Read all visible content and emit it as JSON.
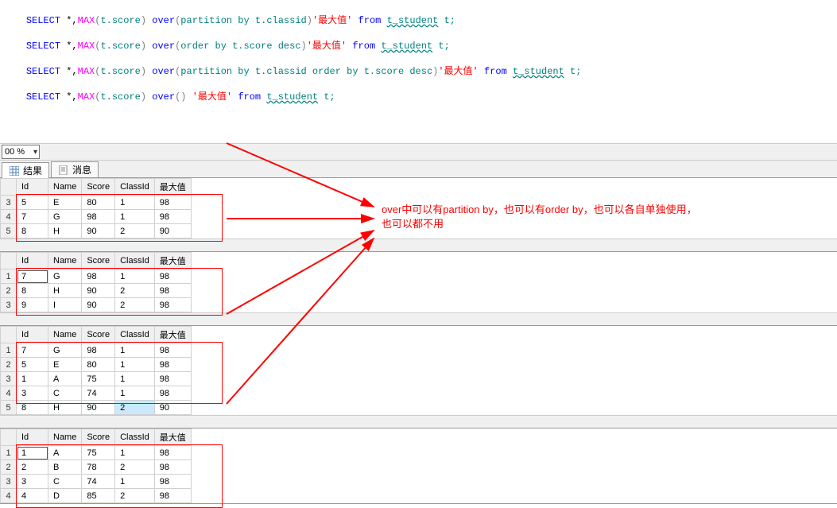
{
  "sql": {
    "line1": {
      "s": "SELECT",
      "star": "*,",
      "fn": "MAX",
      "paren1": "(",
      "arg": "t.score",
      "paren2": ")",
      "over": "over",
      "po": "(",
      "pc": "partition by t.classid",
      "pe": ")",
      "alias": "'最大值'",
      "from": "from",
      "tbl": "t_student",
      "t": "t;"
    },
    "line2": {
      "s": "SELECT",
      "star": "*,",
      "fn": "MAX",
      "paren1": "(",
      "arg": "t.score",
      "paren2": ")",
      "over": "over",
      "po": "(",
      "pc": "order by t.score desc",
      "pe": ")",
      "alias": "'最大值'",
      "from": "from",
      "tbl": "t_student",
      "t": "t;"
    },
    "line3": {
      "s": "SELECT",
      "star": "*,",
      "fn": "MAX",
      "paren1": "(",
      "arg": "t.score",
      "paren2": ")",
      "over": "over",
      "po": "(",
      "pc": "partition by t.classid order by t.score desc",
      "pe": ")",
      "alias": "'最大值'",
      "from": "from",
      "tbl": "t_student",
      "t": "t;"
    },
    "line4": {
      "s": "SELECT",
      "star": "*,",
      "fn": "MAX",
      "paren1": "(",
      "arg": "t.score",
      "paren2": ")",
      "over": "over",
      "po": "(",
      "pc": "",
      "pe": ")",
      "alias": "'最大值'",
      "from": "from",
      "tbl": "t_student",
      "t": "t;"
    }
  },
  "zoom": "00 %",
  "tabs": {
    "results": "结果",
    "messages": "消息"
  },
  "columns": [
    "Id",
    "Name",
    "Score",
    "ClassId",
    "最大值"
  ],
  "grid1": {
    "startRow": 3,
    "rows": [
      [
        "5",
        "E",
        "80",
        "1",
        "98"
      ],
      [
        "7",
        "G",
        "98",
        "1",
        "98"
      ],
      [
        "8",
        "H",
        "90",
        "2",
        "90"
      ]
    ]
  },
  "grid2": {
    "rows": [
      [
        "7",
        "G",
        "98",
        "1",
        "98"
      ],
      [
        "8",
        "H",
        "90",
        "2",
        "98"
      ],
      [
        "9",
        "I",
        "90",
        "2",
        "98"
      ]
    ]
  },
  "grid3": {
    "rows": [
      [
        "7",
        "G",
        "98",
        "1",
        "98"
      ],
      [
        "5",
        "E",
        "80",
        "1",
        "98"
      ],
      [
        "1",
        "A",
        "75",
        "1",
        "98"
      ],
      [
        "3",
        "C",
        "74",
        "1",
        "98"
      ],
      [
        "8",
        "H",
        "90",
        "2",
        "90"
      ]
    ]
  },
  "grid4": {
    "rows": [
      [
        "1",
        "A",
        "75",
        "1",
        "98"
      ],
      [
        "2",
        "B",
        "78",
        "2",
        "98"
      ],
      [
        "3",
        "C",
        "74",
        "1",
        "98"
      ],
      [
        "4",
        "D",
        "85",
        "2",
        "98"
      ]
    ]
  },
  "annotation": {
    "l1": "over中可以有partition by，也可以有order by，也可以各自单独使用，",
    "l2": "也可以都不用"
  }
}
